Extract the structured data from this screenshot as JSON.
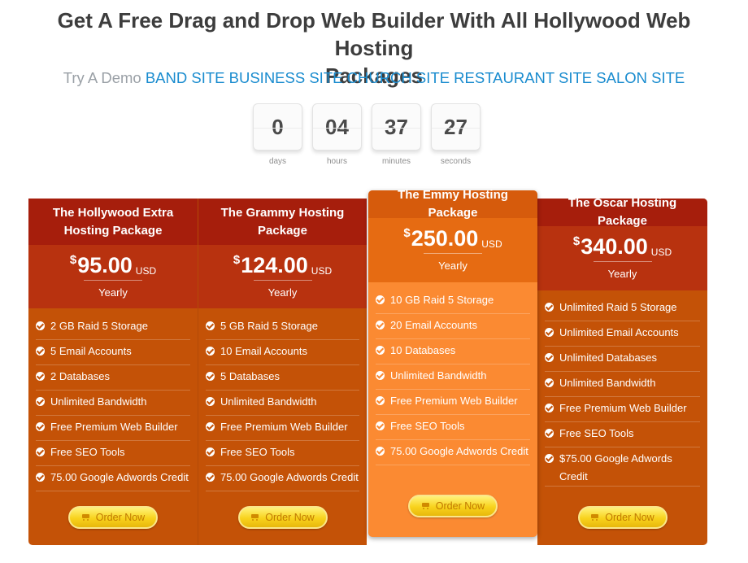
{
  "headline": {
    "line1": "Get A Free Drag and Drop Web Builder With All Hollywood Web Hosting",
    "line2": "Packages"
  },
  "demo": {
    "prefix": "Try A Demo",
    "links": [
      "BAND SITE",
      "BUSINESS SITE",
      "CHURCH SITE",
      "RESTAURANT SITE",
      "SALON SITE"
    ]
  },
  "countdown": [
    {
      "value": "0",
      "label": "days"
    },
    {
      "value": "04",
      "label": "hours"
    },
    {
      "value": "37",
      "label": "minutes"
    },
    {
      "value": "27",
      "label": "seconds"
    }
  ],
  "colors": {
    "header_red": "#a61e0c",
    "body_orange": "#c45207",
    "featured_orange": "#fb8a32",
    "link_blue": "#1a8ccf",
    "button_yellow": "#f8d21c"
  },
  "plans": [
    {
      "name": "The Hollywood Extra Hosting Package",
      "currency": "$",
      "price": "95.00",
      "unit": "USD",
      "period": "Yearly",
      "features": [
        "2 GB Raid 5 Storage",
        "5 Email Accounts",
        "2 Databases",
        "Unlimited Bandwidth",
        "Free Premium Web Builder",
        "Free SEO Tools",
        "75.00 Google Adwords Credit"
      ],
      "button": "Order Now"
    },
    {
      "name": "The Grammy Hosting Package",
      "currency": "$",
      "price": "124.00",
      "unit": "USD",
      "period": "Yearly",
      "features": [
        "5 GB Raid 5 Storage",
        "10 Email Accounts",
        "5 Databases",
        "Unlimited Bandwidth",
        "Free Premium Web Builder",
        "Free SEO Tools",
        "75.00 Google Adwords Credit"
      ],
      "button": "Order Now"
    },
    {
      "name": "The Emmy Hosting Package",
      "currency": "$",
      "price": "250.00",
      "unit": "USD",
      "period": "Yearly",
      "features": [
        "10 GB Raid 5 Storage",
        "20 Email Accounts",
        "10 Databases",
        "Unlimited Bandwidth",
        "Free Premium Web Builder",
        "Free SEO Tools",
        "75.00 Google Adwords Credit"
      ],
      "button": "Order Now"
    },
    {
      "name": "The Oscar Hosting Package",
      "currency": "$",
      "price": "340.00",
      "unit": "USD",
      "period": "Yearly",
      "features": [
        "Unlimited Raid 5 Storage",
        "Unlimited Email Accounts",
        "Unlimited Databases",
        "Unlimited Bandwidth",
        "Free Premium Web Builder",
        "Free SEO Tools",
        "$75.00 Google Adwords Credit"
      ],
      "button": "Order Now"
    }
  ],
  "icons": {
    "feature": "check-circle-icon",
    "button": "cart-icon"
  }
}
